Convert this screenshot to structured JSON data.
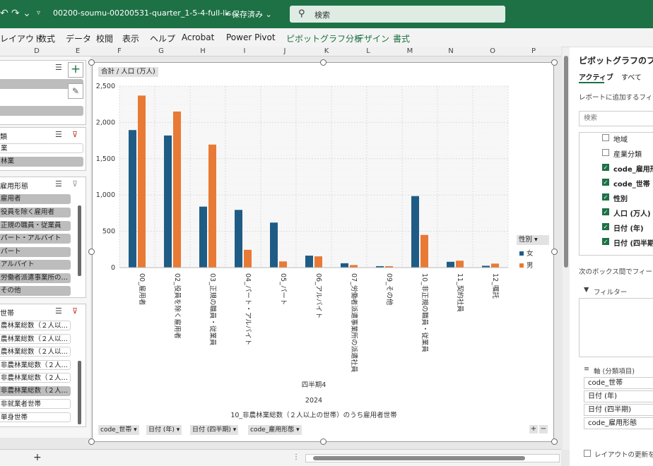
{
  "titlebar": {
    "undo_icon": "undo-icon",
    "redo_icon": "redo-icon",
    "file_name": "00200-soumu-00200531-quarter_1-5-4-full-lis…",
    "save_status": "• 保存済み ⌄",
    "search_placeholder": "検索"
  },
  "ribbon": {
    "tabs": [
      "レイアウト",
      "数式",
      "データ",
      "校閲",
      "表示",
      "ヘルプ",
      "Acrobat",
      "Power Pivot",
      "ピボットグラフ分析",
      "デザイン",
      "書式"
    ]
  },
  "columns": [
    "D",
    "E",
    "F",
    "G",
    "H",
    "I",
    "J",
    "K",
    "L",
    "M",
    "N",
    "O",
    "P"
  ],
  "slicers": {
    "s1": {
      "items": []
    },
    "s2": {
      "header": "類",
      "items": [
        "業",
        "林業"
      ]
    },
    "s3": {
      "header": "雇用形態",
      "items": [
        "雇用者",
        "役員を除く雇用者",
        "正規の職員・従業員",
        "パート・アルバイト",
        "パート",
        "アルバイト",
        "労働者派遣事業所の…",
        "その他"
      ]
    },
    "s4": {
      "header": "世帯",
      "items": [
        "農林業総数（２人以…",
        "農林業総数（２人以…",
        "農林業総数（２人以…",
        "非農林業総数（２人…",
        "非農林業総数（２人…",
        "非農林業総数（２人…",
        "非就業者世帯",
        "単身世帯"
      ]
    }
  },
  "chart": {
    "value_button": "合計 / 人口 (万人)",
    "legend_button": "性別 ▾",
    "field_buttons": [
      "code_世帯 ▾",
      "日付 (年) ▾",
      "日付 (四半期) ▾",
      "code_雇用形態 ▾"
    ],
    "plus": "+",
    "minus": "−"
  },
  "chart_data": {
    "type": "bar",
    "categories": [
      "00_雇用者",
      "02_役員を除く雇用者",
      "03_正規の職員・従業員",
      "04_パート・アルバイト",
      "05_パート",
      "06_アルバイト",
      "07_労働者派遣事業所の派遣社員",
      "09_その他",
      "10_非正規の職員・従業員",
      "11_契約社員",
      "12_嘱託"
    ],
    "series": [
      {
        "name": "女",
        "color": "#1f5c85",
        "values": [
          1895,
          1820,
          840,
          795,
          620,
          165,
          60,
          20,
          985,
          80,
          25
        ]
      },
      {
        "name": "男",
        "color": "#e87a35",
        "values": [
          2370,
          2150,
          1695,
          245,
          85,
          155,
          35,
          20,
          450,
          95,
          55
        ]
      }
    ],
    "ylim": [
      0,
      2500
    ],
    "y_ticks": [
      "0",
      "500",
      "1,000",
      "1,500",
      "2,000",
      "2,500"
    ],
    "x_group_labels": [
      "四半期4",
      "2024",
      "10_非農林業総数（２人以上の世帯）のうち雇用者世帯"
    ],
    "grid": true,
    "legend": "right"
  },
  "pane": {
    "title": "ピボットグラフのフィー…",
    "tabs": [
      "アクティブ",
      "すべて"
    ],
    "hint": "レポートに追加するフィールド…",
    "search_placeholder": "検索",
    "fields": [
      {
        "label": "地域",
        "checked": false
      },
      {
        "label": "産業分類",
        "checked": false
      },
      {
        "label": "code_雇用形",
        "checked": true
      },
      {
        "label": "code_世帯",
        "checked": true
      },
      {
        "label": "性別",
        "checked": true
      },
      {
        "label": "人口 (万人)",
        "checked": true
      },
      {
        "label": "日付 (年)",
        "checked": true
      },
      {
        "label": "日付 (四半期",
        "checked": true
      }
    ],
    "drag_hint": "次のボックス間でフィールドを…",
    "filter_label": "フィルター",
    "axis_label": "軸 (分類項目)",
    "axis_items": [
      "code_世帯",
      "日付 (年)",
      "日付 (四半期)",
      "code_雇用形態"
    ],
    "defer_label": "レイアウトの更新を保…"
  },
  "bottom": {
    "add_sheet": "+"
  }
}
